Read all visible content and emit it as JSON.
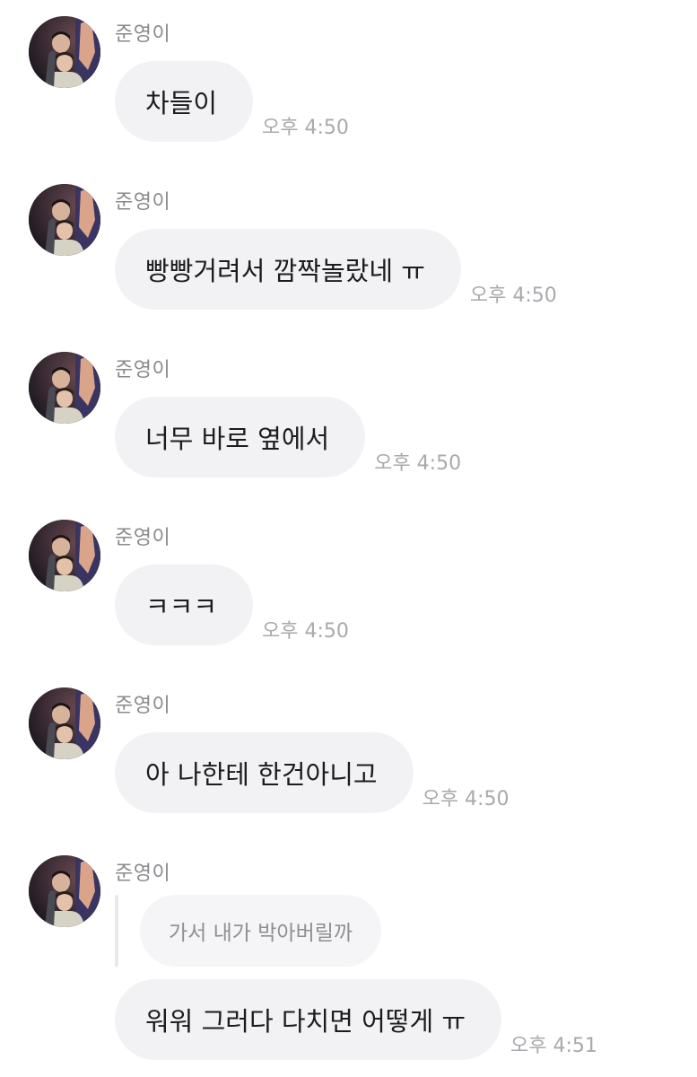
{
  "messages": [
    {
      "sender": "준영이",
      "text": "차들이",
      "time": "오후 4:50"
    },
    {
      "sender": "준영이",
      "text": "빵빵거려서 깜짝놀랐네 ㅠ",
      "time": "오후 4:50"
    },
    {
      "sender": "준영이",
      "text": "너무 바로 옆에서",
      "time": "오후 4:50"
    },
    {
      "sender": "준영이",
      "text": "ㅋㅋㅋ",
      "time": "오후 4:50"
    },
    {
      "sender": "준영이",
      "text": "아 나한테 한건아니고",
      "time": "오후 4:50"
    },
    {
      "sender": "준영이",
      "reply_quote": "가서 내가 박아버릴까",
      "text": "워워 그러다 다치면 어떻게 ㅠ",
      "time": "오후 4:51"
    }
  ],
  "icons": {
    "avatar": "profile-photo"
  },
  "colors": {
    "bubble": "#f2f2f4",
    "sender": "#8a8a8e",
    "time": "#a9a9ae",
    "text": "#1c1c1e"
  }
}
